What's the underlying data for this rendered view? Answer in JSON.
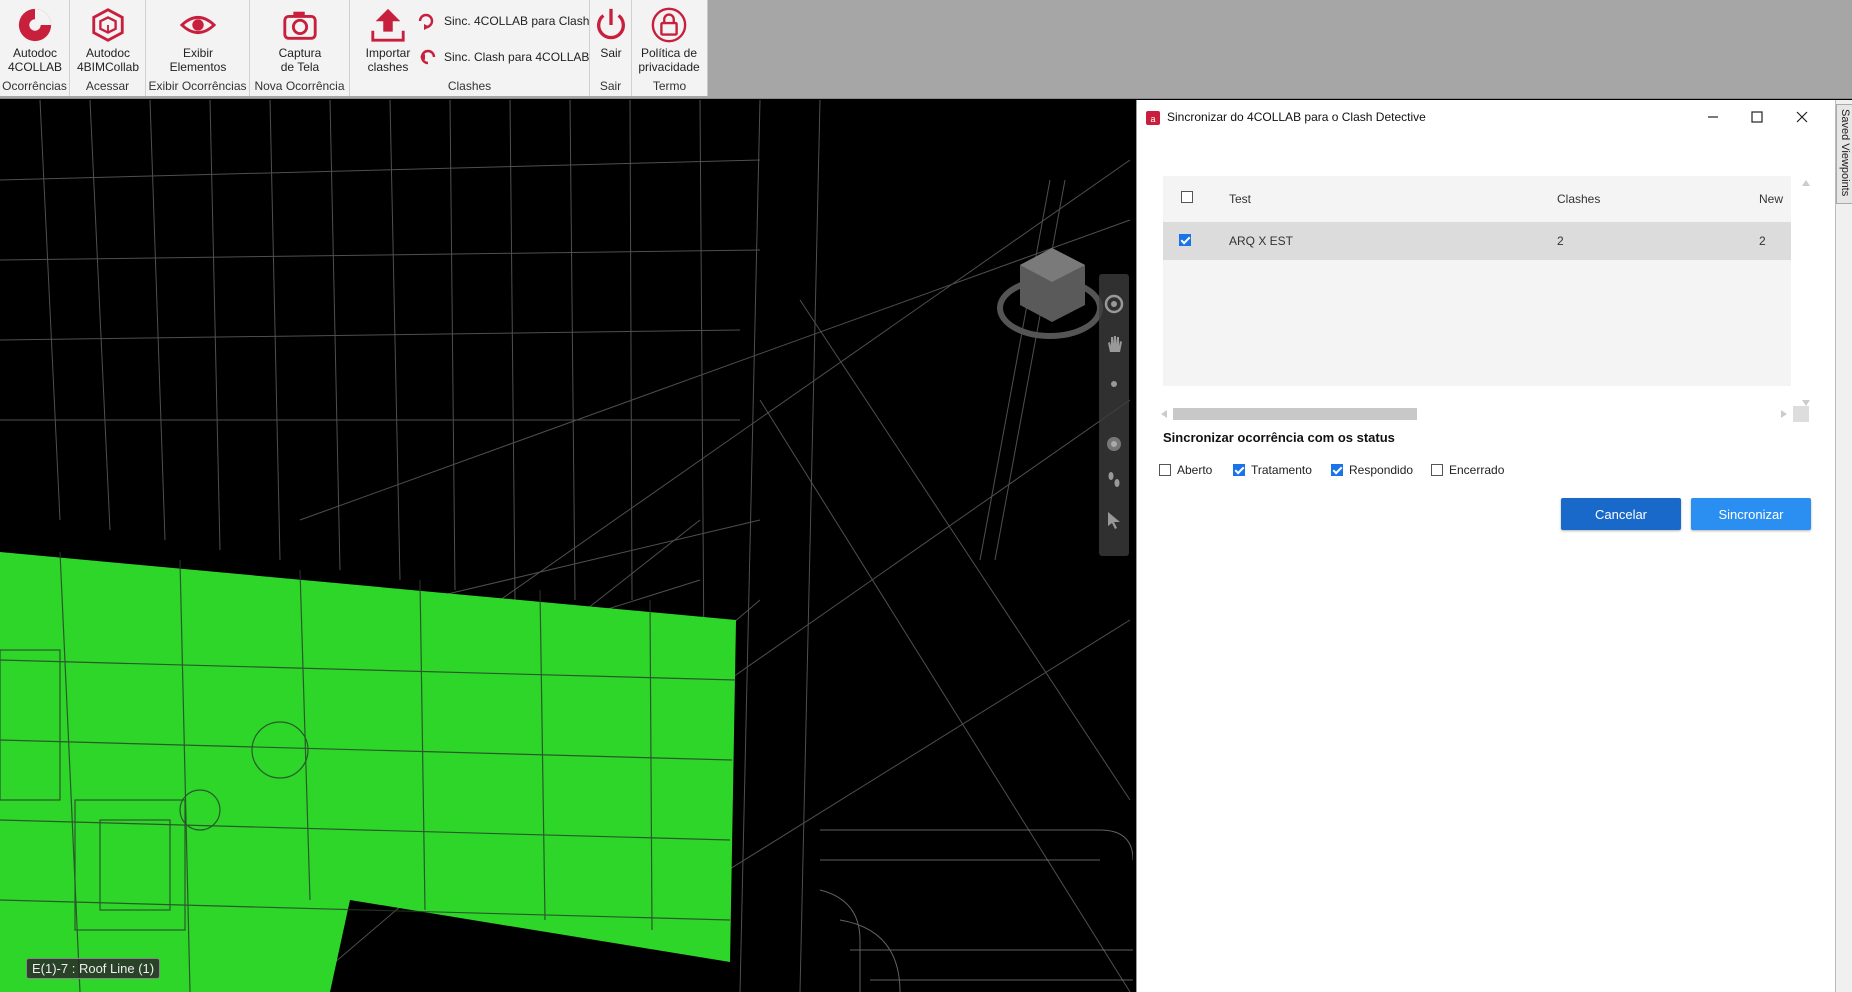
{
  "ribbon": {
    "groups": [
      {
        "label": "Ocorrências",
        "buttons": [
          {
            "label": "Autodoc\n4COLLAB",
            "icon": "autodoc-logo-icon"
          }
        ]
      },
      {
        "label": "Acessar",
        "buttons": [
          {
            "label": "Autodoc\n4BIMCollab",
            "icon": "cube-icon"
          }
        ]
      },
      {
        "label": "Exibir Ocorrências",
        "buttons": [
          {
            "label": "Exibir\nElementos",
            "icon": "eye-icon"
          }
        ]
      },
      {
        "label": "Nova Ocorrência",
        "buttons": [
          {
            "label": "Captura\nde Tela",
            "icon": "camera-icon"
          }
        ]
      },
      {
        "label": "Clashes",
        "buttons": [
          {
            "label": "Importar\nclashes",
            "icon": "upload-icon"
          }
        ],
        "small_buttons": [
          {
            "label": "Sinc. 4COLLAB para Clash",
            "icon": "sync-icon"
          },
          {
            "label": "Sinc. Clash para 4COLLAB",
            "icon": "sync-reverse-icon"
          }
        ]
      },
      {
        "label": "Sair",
        "buttons": [
          {
            "label": "Sair",
            "icon": "power-icon"
          }
        ]
      },
      {
        "label": "Termo",
        "buttons": [
          {
            "label": "Política de\nprivacidade",
            "icon": "lock-icon"
          }
        ]
      }
    ]
  },
  "viewport": {
    "status_tag": "E(1)-7 : Roof Line (1)"
  },
  "dialog": {
    "title": "Sincronizar do 4COLLAB para o Clash Detective",
    "columns": {
      "test": "Test",
      "clashes": "Clashes",
      "new": "New"
    },
    "rows": [
      {
        "checked": true,
        "test": "ARQ X EST",
        "clashes": "2",
        "new": "2"
      }
    ],
    "sync_section_title": "Sincronizar ocorrência com os status",
    "statuses": [
      {
        "label": "Aberto",
        "checked": false
      },
      {
        "label": "Tratamento",
        "checked": true
      },
      {
        "label": "Respondido",
        "checked": true
      },
      {
        "label": "Encerrado",
        "checked": false
      }
    ],
    "cancel_label": "Cancelar",
    "sync_label": "Sincronizar"
  },
  "dock": {
    "tab_label": "Saved Viewpoints"
  },
  "colors": {
    "brand": "#c8203c",
    "primary": "#1869c9",
    "accent": "#2a8ff0",
    "floor": "#2ed62a"
  }
}
